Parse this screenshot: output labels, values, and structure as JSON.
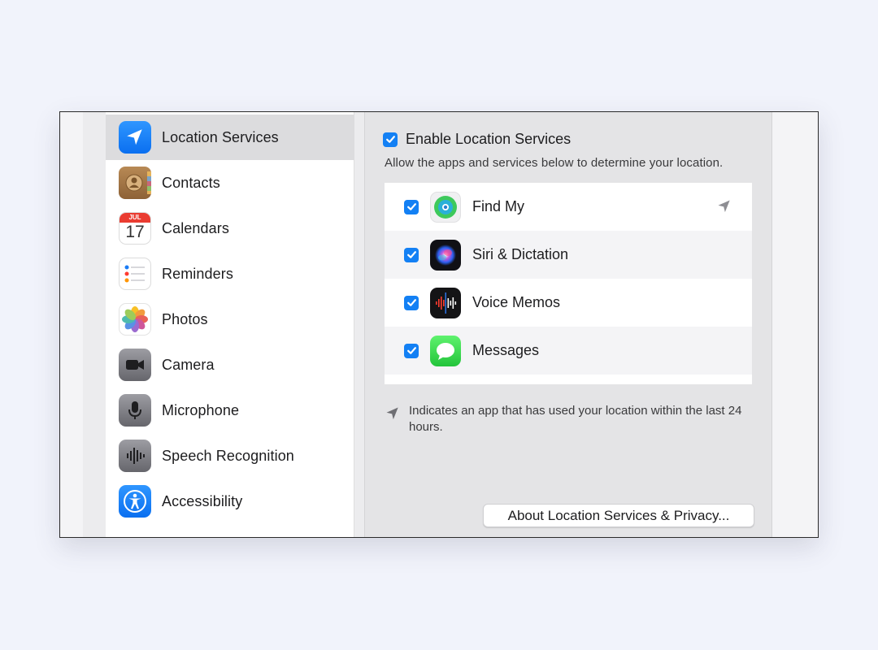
{
  "sidebar": {
    "items": [
      {
        "label": "Location Services",
        "icon": "location-arrow-icon",
        "selected": true
      },
      {
        "label": "Contacts",
        "icon": "contacts-icon",
        "selected": false
      },
      {
        "label": "Calendars",
        "icon": "calendar-icon",
        "selected": false
      },
      {
        "label": "Reminders",
        "icon": "reminders-icon",
        "selected": false
      },
      {
        "label": "Photos",
        "icon": "photos-icon",
        "selected": false
      },
      {
        "label": "Camera",
        "icon": "camera-icon",
        "selected": false
      },
      {
        "label": "Microphone",
        "icon": "microphone-icon",
        "selected": false
      },
      {
        "label": "Speech Recognition",
        "icon": "waveform-icon",
        "selected": false
      },
      {
        "label": "Accessibility",
        "icon": "accessibility-icon",
        "selected": false
      }
    ],
    "calendar_icon": {
      "month": "JUL",
      "day": "17"
    }
  },
  "main": {
    "enable_label": "Enable Location Services",
    "enable_checked": true,
    "description": "Allow the apps and services below to determine your location.",
    "apps": [
      {
        "name": "Find My",
        "checked": true,
        "icon": "find-my-icon",
        "recent_location": true
      },
      {
        "name": "Siri & Dictation",
        "checked": true,
        "icon": "siri-icon",
        "recent_location": false
      },
      {
        "name": "Voice Memos",
        "checked": true,
        "icon": "voice-memos-icon",
        "recent_location": false
      },
      {
        "name": "Messages",
        "checked": true,
        "icon": "messages-icon",
        "recent_location": false
      }
    ],
    "note": "Indicates an app that has used your location within the last 24 hours.",
    "about_button": "About Location Services & Privacy..."
  },
  "colors": {
    "accent": "#1380f4",
    "selected_row": "#dcdcde",
    "page_background": "#f1f3fb"
  }
}
